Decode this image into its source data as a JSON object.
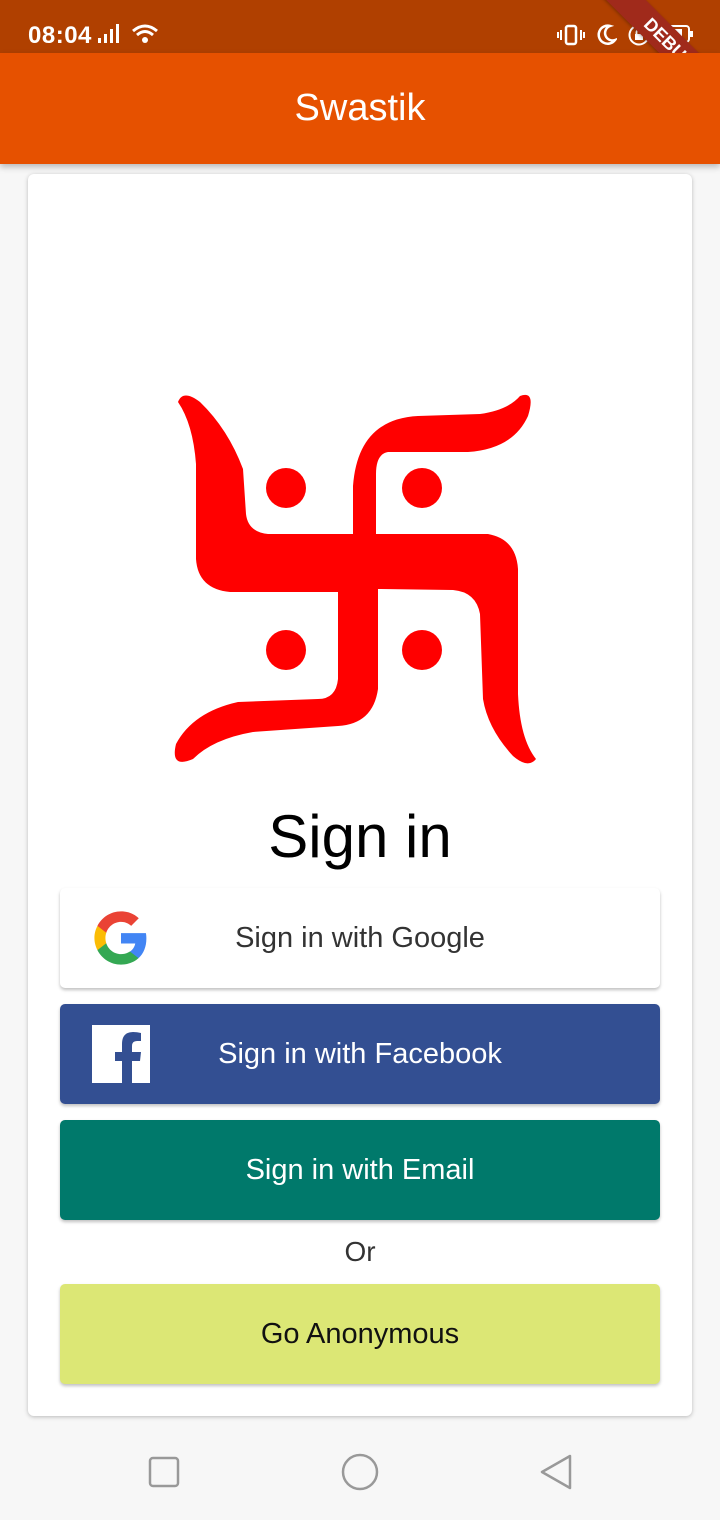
{
  "status_bar": {
    "time": "08:04",
    "debug_label": "DEBUG",
    "icons": [
      "signal-icon",
      "wifi-icon",
      "vibrate-icon",
      "moon-icon",
      "lock-icon",
      "battery-icon"
    ]
  },
  "app_bar": {
    "title": "Swastik"
  },
  "main": {
    "logo": "swastik-icon",
    "title": "Sign in",
    "google_label": "Sign in with Google",
    "facebook_label": "Sign in with Facebook",
    "email_label": "Sign in with Email",
    "or_label": "Or",
    "anonymous_label": "Go Anonymous"
  },
  "colors": {
    "status_bar": "#b04000",
    "app_bar": "#e65100",
    "logo_red": "#ff0000",
    "facebook": "#334f92",
    "email": "#00796b",
    "anonymous": "#dce775"
  },
  "nav_bar": {
    "items": [
      "recent-apps-icon",
      "home-icon",
      "back-icon"
    ]
  }
}
